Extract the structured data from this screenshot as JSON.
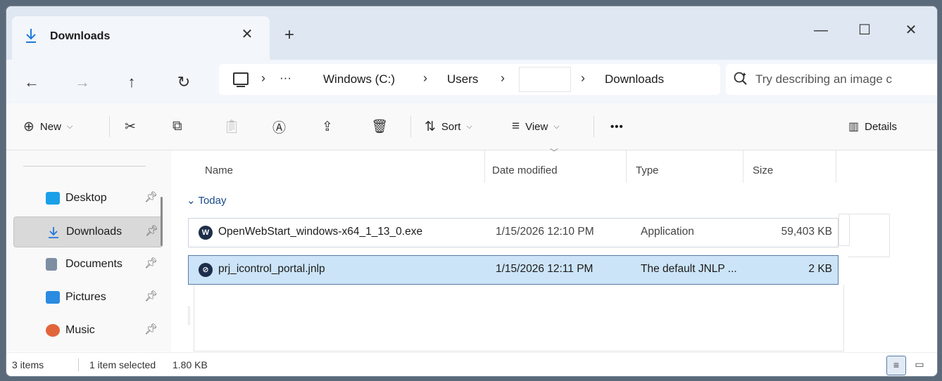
{
  "tab": {
    "title": "Downloads",
    "close": "✕",
    "new_tab": "+"
  },
  "window_controls": {
    "minimize": "—",
    "maximize": "☐",
    "close": "✕"
  },
  "nav": {
    "back": "←",
    "forward": "→",
    "up": "↑",
    "refresh": "↻"
  },
  "address": {
    "ellipsis": "···",
    "crumbs": [
      "Windows (C:)",
      "Users",
      "",
      "Downloads"
    ],
    "sep": "›"
  },
  "search": {
    "placeholder": "Try describing an image c"
  },
  "toolbar": {
    "new_label": "New",
    "sort_label": "Sort",
    "view_label": "View",
    "more_label": "•••",
    "details_label": "Details"
  },
  "sidebar": {
    "items": [
      {
        "label": "Desktop",
        "color": "#1aa0e8"
      },
      {
        "label": "Downloads",
        "color": "#1f7ad9"
      },
      {
        "label": "Documents",
        "color": "#7d8ea3"
      },
      {
        "label": "Pictures",
        "color": "#2a8be0"
      },
      {
        "label": "Music",
        "color": "#e2653a"
      }
    ]
  },
  "columns": {
    "name": "Name",
    "date": "Date modified",
    "type": "Type",
    "size": "Size"
  },
  "group": {
    "label": "Today"
  },
  "files": [
    {
      "name": "OpenWebStart_windows-x64_1_13_0.exe",
      "date": "1/15/2026 12:10 PM",
      "type": "Application",
      "size": "59,403 KB",
      "selected": false
    },
    {
      "name": "prj_icontrol_portal.jnlp",
      "date": "1/15/2026 12:11 PM",
      "type": "The default JNLP ...",
      "size": "2 KB",
      "selected": true
    }
  ],
  "status": {
    "items": "3 items",
    "selected": "1 item selected",
    "size": "1.80 KB"
  }
}
